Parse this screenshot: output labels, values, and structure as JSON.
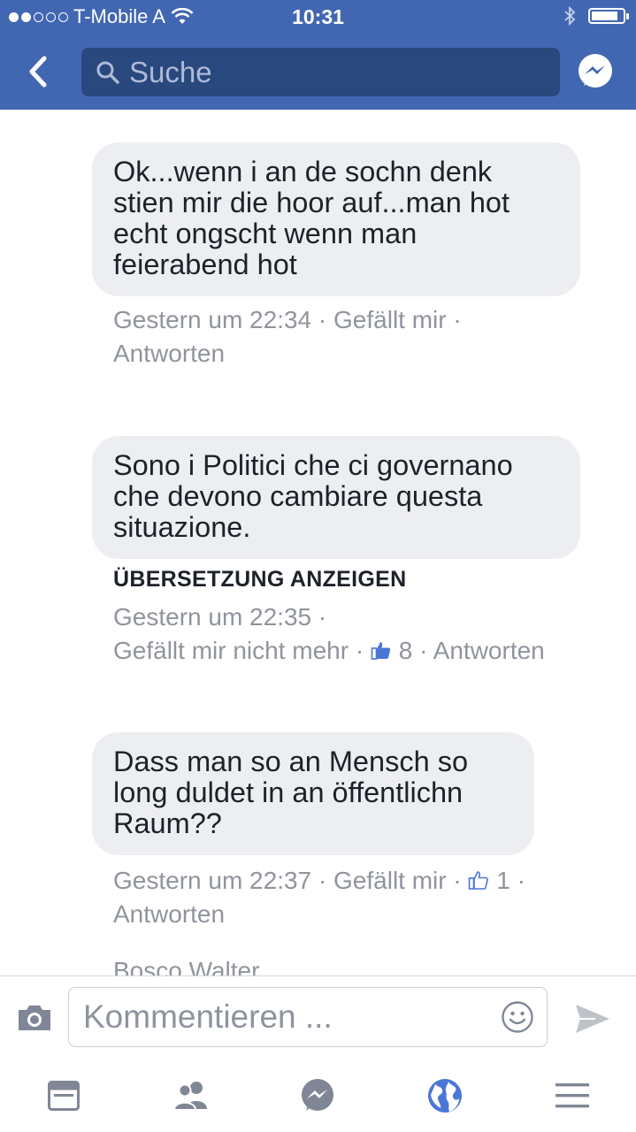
{
  "status_bar": {
    "carrier": "T-Mobile A",
    "time": "10:31",
    "signal_bars_filled": 2,
    "signal_bars_total": 5,
    "battery_level": 0.85
  },
  "header": {
    "search_placeholder": "Suche",
    "back_icon": "chevron-left-icon",
    "messenger_icon": "messenger-icon"
  },
  "comments": [
    {
      "text": "Ok...wenn i an de sochn denk stien mir die hoor auf...man hot echt ongscht wenn man feierabend hot",
      "time": "Gestern um 22:34",
      "like_label": "Gefällt mir",
      "reply_label": "Antworten",
      "like_count": ""
    },
    {
      "text": "Sono i Politici che ci governano che devono cambiare questa situazione.",
      "translate_label": "ÜBERSETZUNG ANZEIGEN",
      "time": "Gestern um 22:35",
      "like_label": "Gefällt mir nicht mehr",
      "reply_label": "Antworten",
      "like_count": "8"
    },
    {
      "text": "Dass man so an Mensch so long duldet in an öffentlichn Raum??",
      "time": "Gestern um 22:37",
      "like_label": "Gefällt mir",
      "reply_label": "Antworten",
      "like_count": "1"
    }
  ],
  "next_comment_author": "Bosco Walter",
  "composer": {
    "placeholder": "Kommentieren ...",
    "camera_icon": "camera-icon",
    "emoji_icon": "smiley-icon",
    "send_icon": "send-icon"
  },
  "tab_bar": {
    "tabs": [
      "news-feed-icon",
      "friends-icon",
      "messenger-icon",
      "globe-icon",
      "menu-icon"
    ],
    "active_tab": "globe-icon"
  },
  "colors": {
    "brand_blue": "#4267b2",
    "search_bg": "#29487d",
    "bubble_bg": "#edeef1",
    "meta_gray": "#90949c",
    "like_blue": "#4a76d6"
  }
}
